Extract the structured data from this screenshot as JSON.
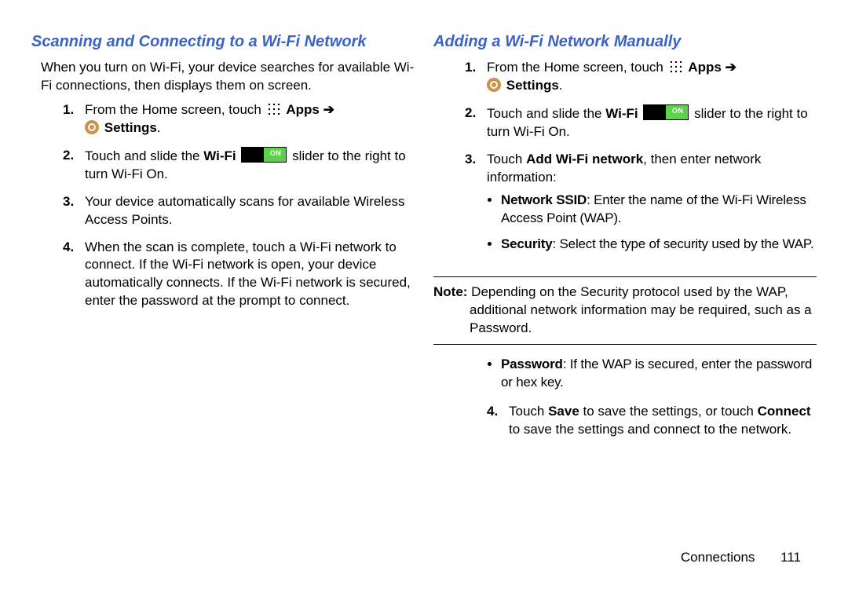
{
  "left": {
    "heading": "Scanning and Connecting to a Wi-Fi Network",
    "intro": "When you turn on Wi-Fi, your device searches for available Wi-Fi connections, then displays them on screen.",
    "step1_a": "From the Home screen, touch ",
    "apps_label": " Apps ",
    "arrow": "➔",
    "settings_label": " Settings",
    "period": ".",
    "step2_a": "Touch and slide the ",
    "wifi_label": "Wi-Fi ",
    "step2_b": " slider to the right to turn Wi-Fi On.",
    "step3": "Your device automatically scans for available Wireless Access Points.",
    "step4": "When the scan is complete, touch a Wi-Fi network to connect. If the Wi-Fi network is open, your device automatically connects. If the Wi-Fi network is secured, enter the password at the prompt to connect."
  },
  "right": {
    "heading": "Adding a Wi-Fi Network Manually",
    "step1_a": "From the Home screen, touch ",
    "apps_label": " Apps ",
    "arrow": "➔",
    "settings_label": " Settings",
    "period": ".",
    "step2_a": "Touch and slide the ",
    "wifi_label": "Wi-Fi ",
    "step2_b": " slider to the right to turn Wi-Fi On.",
    "step3_a": "Touch ",
    "step3_bold": "Add Wi-Fi network",
    "step3_b": ", then enter network information:",
    "bullet1_bold": "Network SSID",
    "bullet1_rest": ": Enter the name of the Wi-Fi Wireless Access Point (WAP).",
    "bullet2_bold": "Security",
    "bullet2_rest": ": Select the type of security used by the WAP.",
    "note_label": "Note:",
    "note_text": " Depending on the Security protocol used by the WAP, additional network information may be required, such as a Password.",
    "bullet3_bold": "Password",
    "bullet3_rest": ": If the WAP is secured, enter the password or hex key.",
    "step4_a": "Touch ",
    "step4_b1": "Save",
    "step4_c": " to save the settings, or touch ",
    "step4_b2": "Connect",
    "step4_d": " to save the settings and connect to the network."
  },
  "footer": {
    "section": "Connections",
    "page": "111"
  }
}
